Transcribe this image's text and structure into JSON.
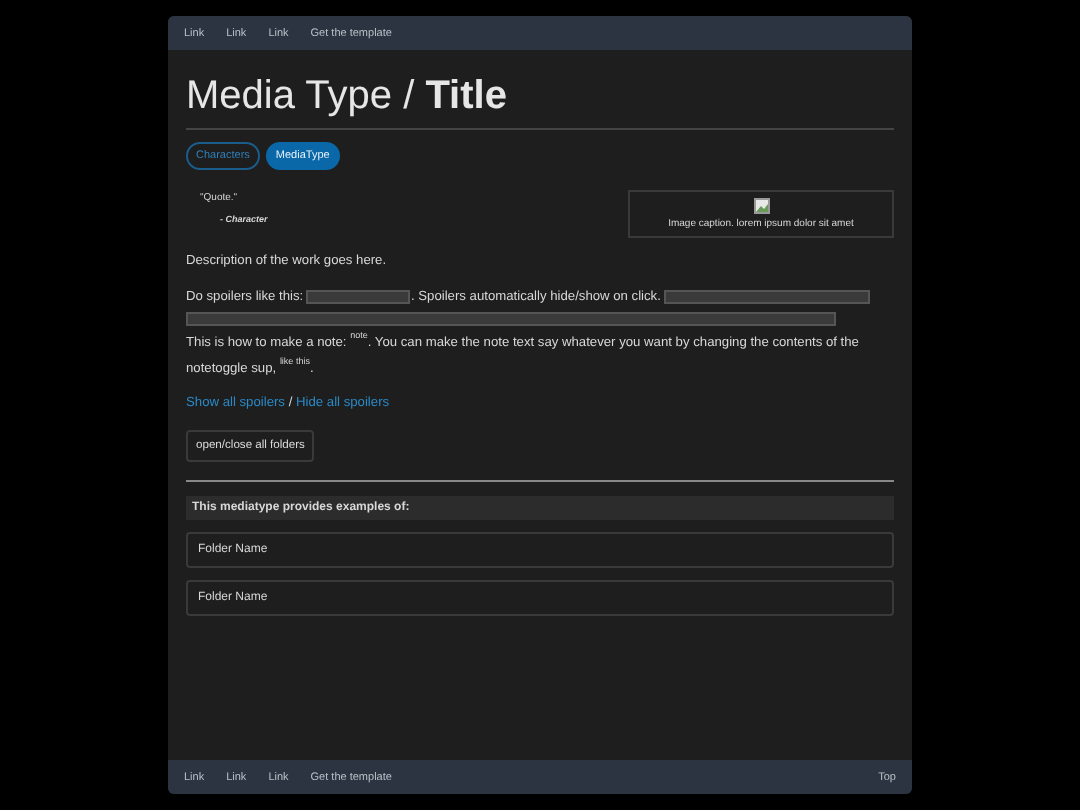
{
  "top_nav": {
    "links": [
      "Link",
      "Link",
      "Link",
      "Get the template"
    ]
  },
  "title": {
    "media_type": "Media Type /",
    "name": "Title"
  },
  "tags": [
    {
      "label": "Characters",
      "selected": false
    },
    {
      "label": "MediaType",
      "selected": true
    }
  ],
  "quote": {
    "text": "\"Quote.\"",
    "attribution": "- Character"
  },
  "image": {
    "caption": "Image caption. lorem ipsum dolor sit amet"
  },
  "description": "Description of the work goes here.",
  "spoiler_paragraph": [
    {
      "kind": "text",
      "text": "Do spoilers like this: "
    },
    {
      "kind": "spoiler"
    },
    {
      "kind": "text",
      "text": ". Spoilers automatically hide/show on click. "
    },
    {
      "kind": "spoiler"
    }
  ],
  "note_paragraph": [
    {
      "kind": "text",
      "text": "This is how to make a note: "
    },
    {
      "kind": "note",
      "text": "note"
    },
    {
      "kind": "text",
      "text": ". You can make the note text say whatever you want by changing the contents of the notetoggle sup, "
    },
    {
      "kind": "note",
      "text": "like this"
    },
    {
      "kind": "text",
      "text": "."
    }
  ],
  "spoiler_links": {
    "show": "Show all spoilers",
    "separator": "/",
    "hide": "Hide all spoilers"
  },
  "folder_button": "open/close all folders",
  "examples_header": "This mediatype provides examples of:",
  "folders": [
    {
      "label": "Folder Name"
    },
    {
      "label": "Folder Name"
    }
  ],
  "bottom_nav": {
    "links": [
      "Link",
      "Link",
      "Link",
      "Get the template"
    ],
    "top": "Top"
  }
}
